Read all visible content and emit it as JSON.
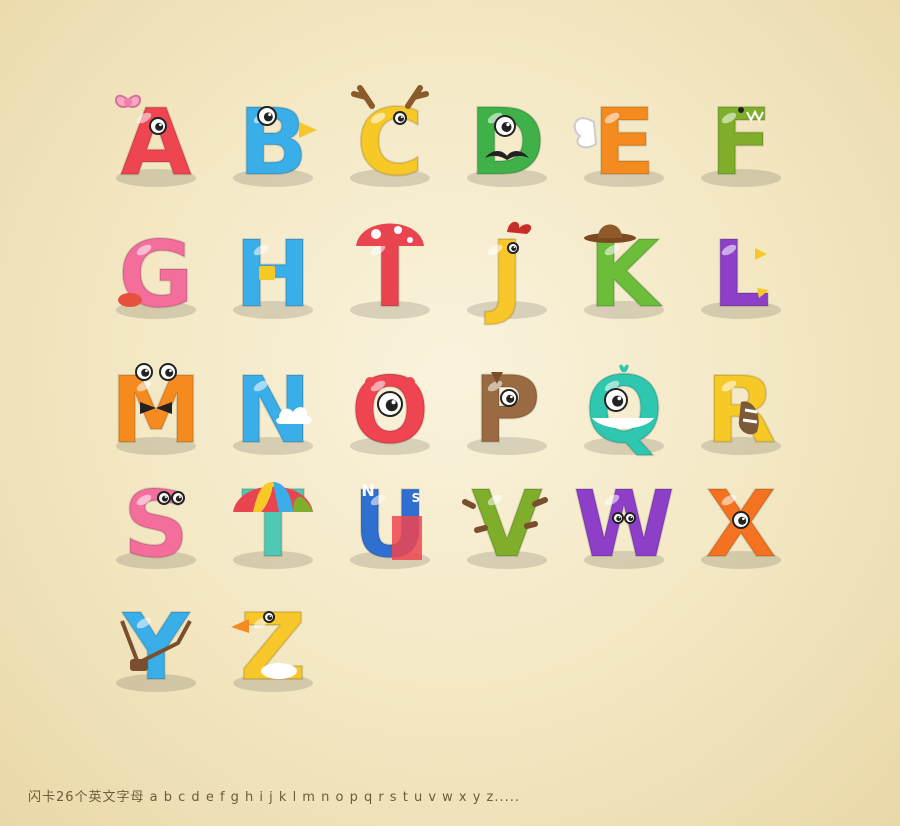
{
  "letters": [
    {
      "char": "A",
      "color": "#ee4550",
      "accessory": "bow"
    },
    {
      "char": "B",
      "color": "#3aaee8",
      "accessory": "beak"
    },
    {
      "char": "C",
      "color": "#f6c927",
      "accessory": "antlers"
    },
    {
      "char": "D",
      "color": "#3fb148",
      "accessory": "eye-mustache"
    },
    {
      "char": "E",
      "color": "#f58b1f",
      "accessory": "wing"
    },
    {
      "char": "F",
      "color": "#7fae2a",
      "accessory": "dino-face"
    },
    {
      "char": "G",
      "color": "#f46e9c",
      "accessory": "tongue"
    },
    {
      "char": "H",
      "color": "#3aaee8",
      "accessory": "tape"
    },
    {
      "char": "I",
      "color": "#e84550",
      "accessory": "mushroom-cap"
    },
    {
      "char": "J",
      "color": "#f8c72b",
      "accessory": "rooster-comb"
    },
    {
      "char": "K",
      "color": "#6cbd3a",
      "accessory": "cowboy-hat"
    },
    {
      "char": "L",
      "color": "#8d3fc8",
      "accessory": "spikes"
    },
    {
      "char": "M",
      "color": "#f58b1f",
      "accessory": "eyes-bowtie"
    },
    {
      "char": "N",
      "color": "#3aaee8",
      "accessory": "cloud"
    },
    {
      "char": "O",
      "color": "#ee4550",
      "accessory": "monster-eye"
    },
    {
      "char": "P",
      "color": "#9a6a43",
      "accessory": "horse-head"
    },
    {
      "char": "Q",
      "color": "#2fc7b0",
      "accessory": "whale"
    },
    {
      "char": "R",
      "color": "#f6c927",
      "accessory": "raccoon-tail"
    },
    {
      "char": "S",
      "color": "#f46e9c",
      "accessory": "worm-eyes"
    },
    {
      "char": "T",
      "color": "#4fc9b4",
      "accessory": "umbrella"
    },
    {
      "char": "U",
      "color": "#2f6fd0",
      "accessory": "magnet"
    },
    {
      "char": "V",
      "color": "#7fae2a",
      "accessory": "cactus-spikes"
    },
    {
      "char": "W",
      "color": "#8d3fc8",
      "accessory": "little-eyes"
    },
    {
      "char": "X",
      "color": "#f57320",
      "accessory": "starfish-eye"
    },
    {
      "char": "Y",
      "color": "#3aaee8",
      "accessory": "slingshot"
    },
    {
      "char": "Z",
      "color": "#f8c72b",
      "accessory": "duck"
    }
  ],
  "magnet_labels": {
    "north": "N",
    "south": "S"
  },
  "caption": "闪卡26个英文字母 a b c d e f g h i j k l m n o p q r s t u v w x y z....."
}
